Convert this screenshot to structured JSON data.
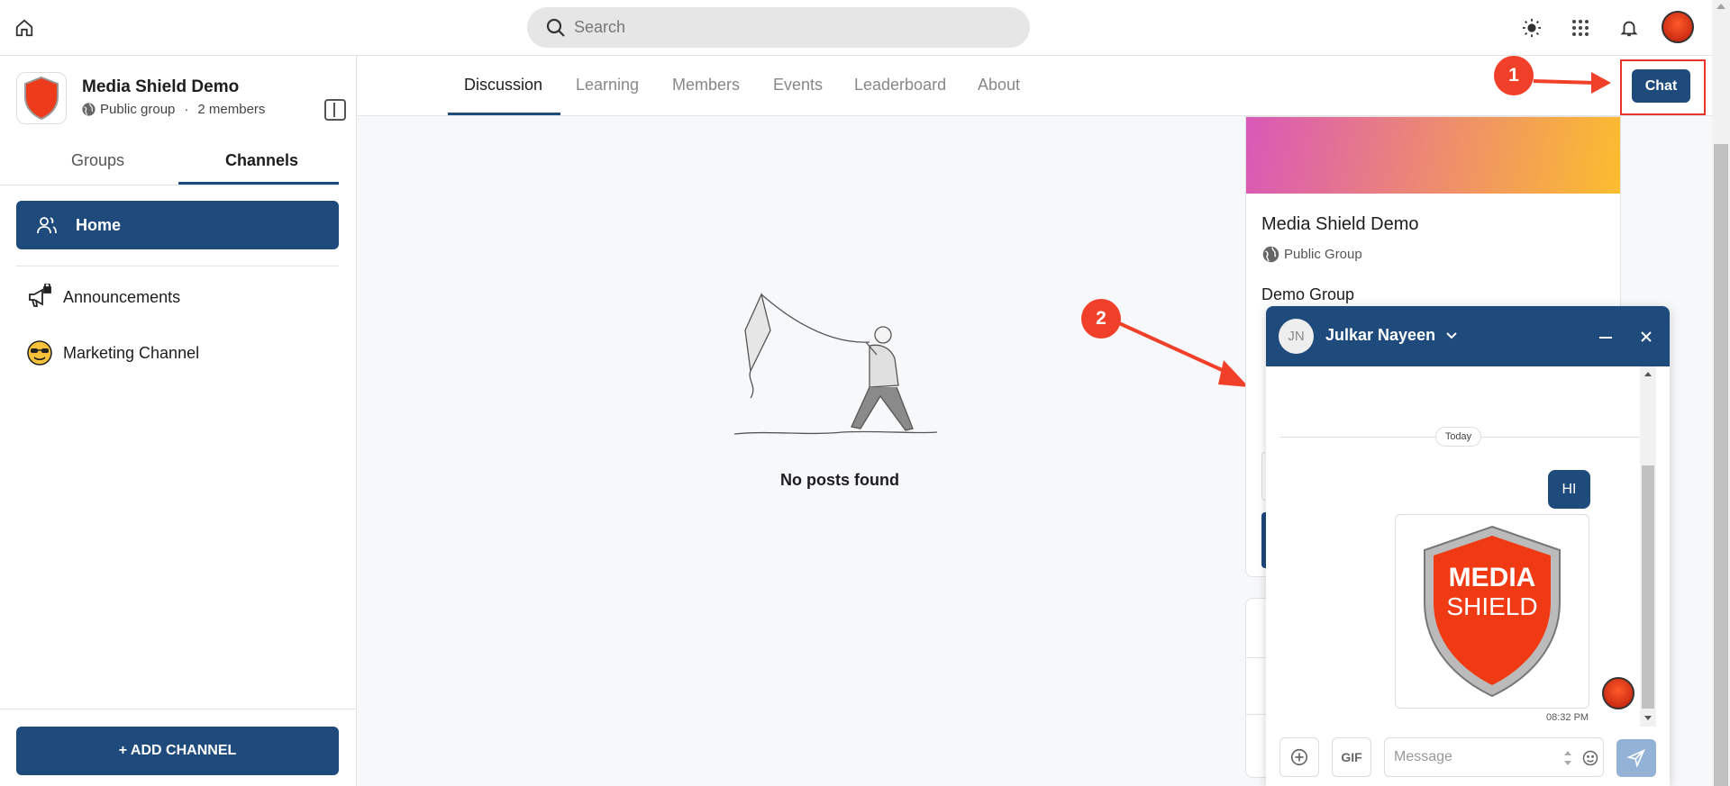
{
  "topbar": {
    "search_placeholder": "Search",
    "icons": [
      "home-icon",
      "search-icon",
      "sun-icon",
      "apps-grid-icon",
      "bell-icon",
      "avatar"
    ]
  },
  "group": {
    "name": "Media Shield Demo",
    "visibility": "Public group",
    "separator": "·",
    "members": "2 members"
  },
  "sidebar": {
    "tabs": [
      {
        "label": "Groups",
        "active": false
      },
      {
        "label": "Channels",
        "active": true
      }
    ],
    "items": [
      {
        "label": "Home",
        "icon": "users-icon",
        "active": true
      },
      {
        "label": "Announcements",
        "icon": "megaphone-lock-icon",
        "active": false
      },
      {
        "label": "Marketing Channel",
        "icon": "sunglasses-emoji-icon",
        "active": false
      }
    ],
    "add_channel_label": "+ ADD CHANNEL"
  },
  "main": {
    "tabs": [
      {
        "label": "Discussion",
        "active": true
      },
      {
        "label": "Learning",
        "active": false
      },
      {
        "label": "Members",
        "active": false
      },
      {
        "label": "Events",
        "active": false
      },
      {
        "label": "Leaderboard",
        "active": false
      },
      {
        "label": "About",
        "active": false
      }
    ],
    "chat_button": "Chat",
    "empty_text": "No posts found"
  },
  "annotations": {
    "badge1": "1",
    "badge2": "2",
    "color": "#f0402a"
  },
  "info_card": {
    "title": "Media Shield Demo",
    "visibility": "Public Group",
    "description": "Demo Group"
  },
  "chat": {
    "avatar_initials": "JN",
    "contact_name": "Julkar Nayeen",
    "day_label": "Today",
    "messages": [
      {
        "type": "text",
        "text": "HI"
      },
      {
        "type": "image",
        "alt": "Media Shield logo",
        "logo_text": [
          "MEDIA",
          "SHIELD"
        ]
      }
    ],
    "time": "08:32 PM",
    "gif_label": "GIF",
    "message_placeholder": "Message"
  },
  "colors": {
    "primary": "#1f4a7c",
    "annotation": "#f0402a"
  }
}
